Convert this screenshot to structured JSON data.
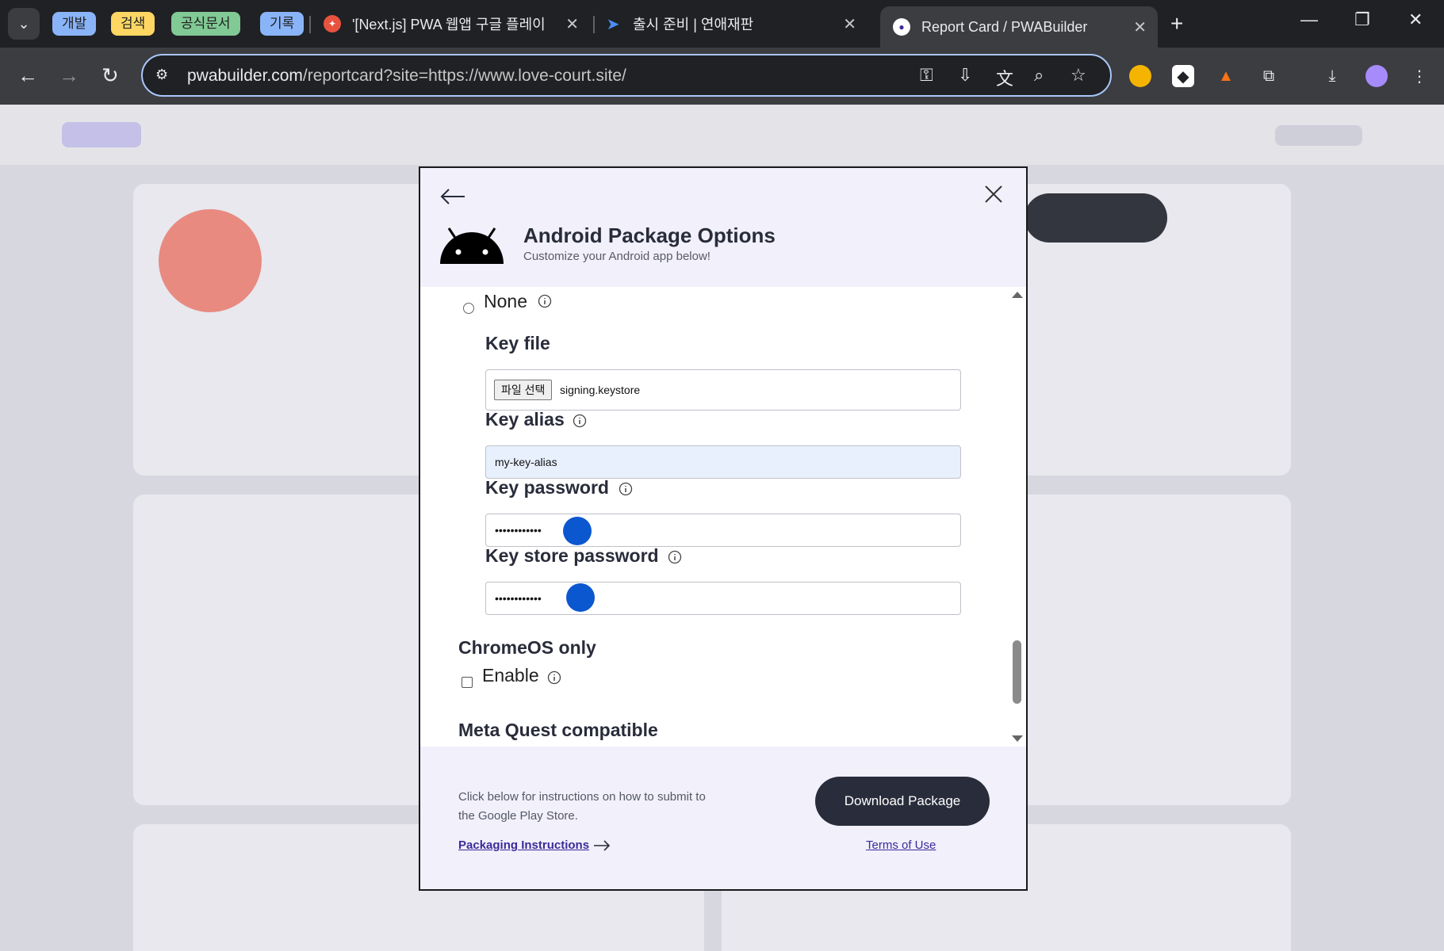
{
  "browser": {
    "tab_groups": [
      {
        "label": "개발",
        "color": "#8ab4f8"
      },
      {
        "label": "검색",
        "color": "#fdd663"
      },
      {
        "label": "공식문서",
        "color": "#81c995"
      },
      {
        "label": "기록",
        "color": "#8ab4f8"
      }
    ],
    "tabs": [
      {
        "title": "'[Next.js] PWA 웹앱 구글 플레이",
        "active": false
      },
      {
        "title": "출시 준비 | 연애재판",
        "active": false
      },
      {
        "title": "Report Card / PWABuilder",
        "active": true
      }
    ],
    "url_host": "pwabuilder.com",
    "url_rest": "/reportcard?site=https://www.love-court.site/"
  },
  "modal": {
    "title": "Android Package Options",
    "subtitle": "Customize your Android app below!",
    "signing": {
      "none_label": "None",
      "key_file_label": "Key file",
      "file_button": "파일 선택",
      "file_name": "signing.keystore",
      "key_alias_label": "Key alias",
      "key_alias_value": "my-key-alias",
      "key_password_label": "Key password",
      "key_password_value": "••••••••••••",
      "key_store_password_label": "Key store password",
      "key_store_password_value": "••••••••••••"
    },
    "chromeos": {
      "section": "ChromeOS only",
      "enable_label": "Enable"
    },
    "meta_quest": {
      "section": "Meta Quest compatible"
    },
    "footer": {
      "instructions_text": "Click below for instructions on how to submit to the Google Play Store.",
      "packaging_link": "Packaging Instructions",
      "download_button": "Download Package",
      "terms_link": "Terms of Use"
    }
  },
  "colors": {
    "accent": "#292c3a",
    "link": "#3a2b9c",
    "header_bg": "#f1f0fb",
    "cursor": "#0b57d0"
  }
}
